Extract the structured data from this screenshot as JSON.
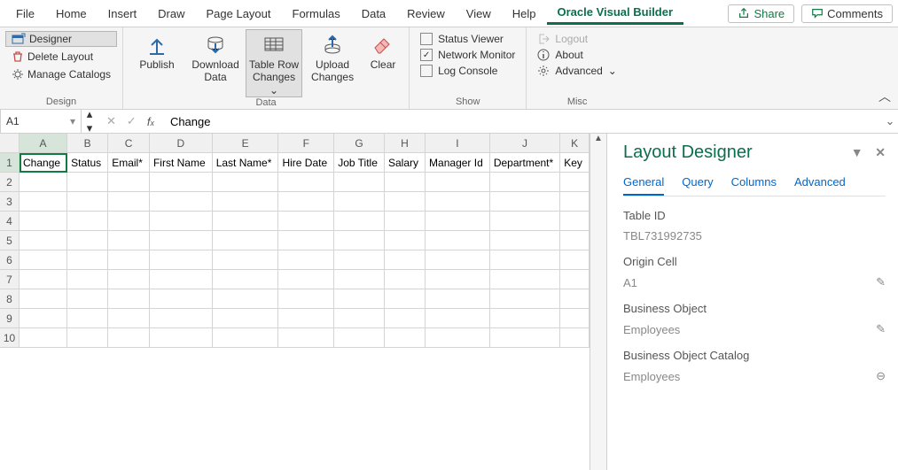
{
  "tabs": {
    "file": "File",
    "home": "Home",
    "insert": "Insert",
    "draw": "Draw",
    "pageLayout": "Page Layout",
    "formulas": "Formulas",
    "data": "Data",
    "review": "Review",
    "view": "View",
    "help": "Help",
    "ovb": "Oracle Visual Builder"
  },
  "actions": {
    "share": "Share",
    "comments": "Comments"
  },
  "ribbon": {
    "design": {
      "label": "Design",
      "designer": "Designer",
      "deleteLayout": "Delete Layout",
      "manageCatalogs": "Manage Catalogs"
    },
    "data": {
      "label": "Data",
      "publish": "Publish",
      "download": "Download Data",
      "tableRow": "Table Row Changes",
      "upload": "Upload Changes",
      "clear": "Clear"
    },
    "show": {
      "label": "Show",
      "statusViewer": "Status Viewer",
      "networkMonitor": "Network Monitor",
      "logConsole": "Log Console"
    },
    "misc": {
      "label": "Misc",
      "logout": "Logout",
      "about": "About",
      "advanced": "Advanced"
    }
  },
  "nameBox": "A1",
  "formula": "Change",
  "columns": [
    "A",
    "B",
    "C",
    "D",
    "E",
    "F",
    "G",
    "H",
    "I",
    "J",
    "K"
  ],
  "headers": {
    "A": "Change",
    "B": "Status",
    "C": "Email*",
    "D": "First Name",
    "E": "Last Name*",
    "F": "Hire Date",
    "G": "Job Title",
    "H": "Salary",
    "I": "Manager Id",
    "J": "Department*",
    "K": "Key"
  },
  "rows": [
    "1",
    "2",
    "3",
    "4",
    "5",
    "6",
    "7",
    "8",
    "9",
    "10"
  ],
  "panel": {
    "title": "Layout Designer",
    "tabs": {
      "general": "General",
      "query": "Query",
      "columns": "Columns",
      "advanced": "Advanced"
    },
    "fields": {
      "tableId": {
        "label": "Table ID",
        "value": "TBL731992735"
      },
      "originCell": {
        "label": "Origin Cell",
        "value": "A1"
      },
      "businessObject": {
        "label": "Business Object",
        "value": "Employees"
      },
      "catalog": {
        "label": "Business Object Catalog",
        "value": "Employees"
      }
    }
  }
}
